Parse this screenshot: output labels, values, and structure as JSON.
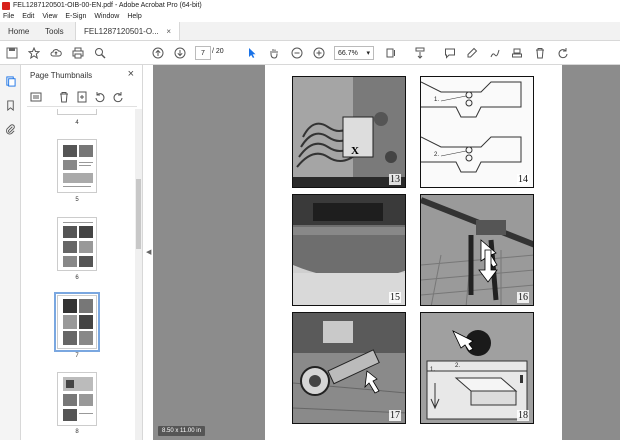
{
  "window": {
    "title": "FEL1287120501-OIB-00-EN.pdf - Adobe Acrobat Pro (64-bit)"
  },
  "menu": [
    "File",
    "Edit",
    "View",
    "E-Sign",
    "Window",
    "Help"
  ],
  "tabs": {
    "home": "Home",
    "tools": "Tools",
    "doc": "FEL1287120501-O...",
    "close": "×"
  },
  "toolbar": {
    "page_current": "7",
    "page_total": "/ 20",
    "zoom": "66.7%",
    "zoom_caret": "▾"
  },
  "thumbnails": {
    "title": "Page Thumbnails",
    "close": "×",
    "items": [
      {
        "label": "4"
      },
      {
        "label": "5"
      },
      {
        "label": "6"
      },
      {
        "label": "7",
        "selected": true
      },
      {
        "label": "8"
      }
    ]
  },
  "document": {
    "figures": [
      "13",
      "14",
      "15",
      "16",
      "17",
      "18"
    ],
    "fig13_marker": "X",
    "fig14_labels": [
      "1.",
      "2."
    ],
    "fig18_labels": [
      "1.",
      "2."
    ],
    "page_size": "8.50 x 11.00 in"
  },
  "colors": {
    "acrobat_red": "#d7201b",
    "selection": "#7aa7e0",
    "workspace": "#8c8c8c"
  }
}
